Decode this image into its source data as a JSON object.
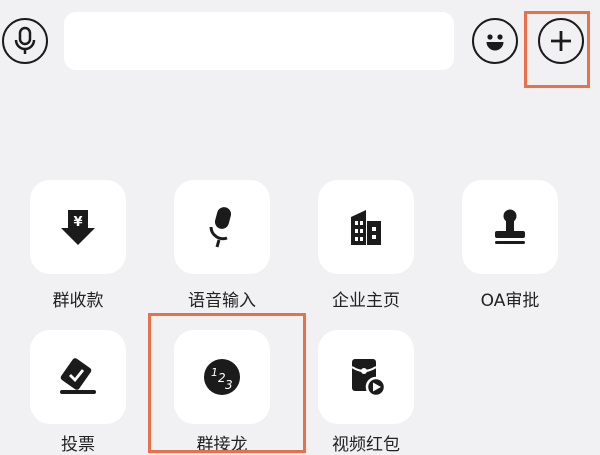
{
  "input": {
    "value": "",
    "placeholder": ""
  },
  "actions": [
    {
      "id": "group-payment",
      "label": "群收款",
      "icon": "yuan-down-arrow-icon"
    },
    {
      "id": "voice-input",
      "label": "语音输入",
      "icon": "microphone-icon"
    },
    {
      "id": "company-homepage",
      "label": "企业主页",
      "icon": "building-icon"
    },
    {
      "id": "oa-approval",
      "label": "OA审批",
      "icon": "stamp-icon"
    },
    {
      "id": "vote",
      "label": "投票",
      "icon": "ballot-icon"
    },
    {
      "id": "group-relay",
      "label": "群接龙",
      "icon": "relay-123-icon"
    },
    {
      "id": "video-red-packet",
      "label": "视频红包",
      "icon": "video-envelope-icon"
    }
  ],
  "colors": {
    "background": "#f1f1f4",
    "tile": "#ffffff",
    "icon": "#1b1b1b",
    "highlight": "#e8704a"
  }
}
